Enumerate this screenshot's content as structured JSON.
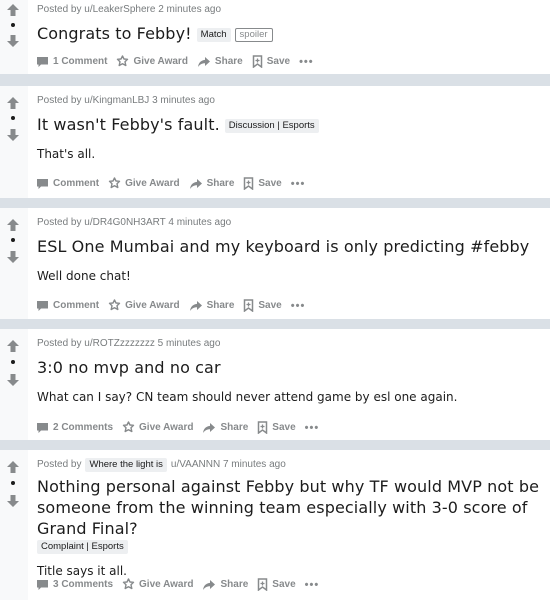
{
  "posts": [
    {
      "posted_by": "Posted by",
      "user": "u/LeakerSphere",
      "time": "2 minutes ago",
      "title": "Congrats to Febby!",
      "flair": "Match",
      "spoiler": "spoiler",
      "comments": "1 Comment",
      "award": "Give Award",
      "share": "Share",
      "save": "Save",
      "more": "•••"
    },
    {
      "posted_by": "Posted by",
      "user": "u/KingmanLBJ",
      "time": "3 minutes ago",
      "title": "It wasn't Febby's fault.",
      "flair": "Discussion | Esports",
      "body": "That's all.",
      "comments": "Comment",
      "award": "Give Award",
      "share": "Share",
      "save": "Save",
      "more": "•••"
    },
    {
      "posted_by": "Posted by",
      "user": "u/DR4G0NH3ART",
      "time": "4 minutes ago",
      "title": "ESL One Mumbai and my keyboard is only predicting #febby",
      "body": "Well done chat!",
      "comments": "Comment",
      "award": "Give Award",
      "share": "Share",
      "save": "Save",
      "more": "•••"
    },
    {
      "posted_by": "Posted by",
      "user": "u/ROTZzzzzzzz",
      "time": "5 minutes ago",
      "title": "3:0 no mvp and no car",
      "body": "What can I say? CN team should never attend game by esl one again.",
      "comments": "2 Comments",
      "award": "Give Award",
      "share": "Share",
      "save": "Save",
      "more": "•••"
    },
    {
      "posted_by": "Posted by",
      "user_flair": "Where the light is",
      "user": "u/VAANNN",
      "time": "7 minutes ago",
      "title": "Nothing personal against Febby but why TF would MVP not be someone from the winning team especially with 3-0 score of Grand Final?",
      "flair": "Complaint | Esports",
      "body": "Title says it all.",
      "comments": "3 Comments",
      "award": "Give Award",
      "share": "Share",
      "save": "Save",
      "more": "•••"
    }
  ],
  "colors": {
    "feed_background": "#dae0e6",
    "card_background": "#ffffff",
    "vote_column": "#f8f9fa",
    "meta_text": "#787c7e",
    "action_text": "#878a8c",
    "flair_background": "#edeff1"
  }
}
